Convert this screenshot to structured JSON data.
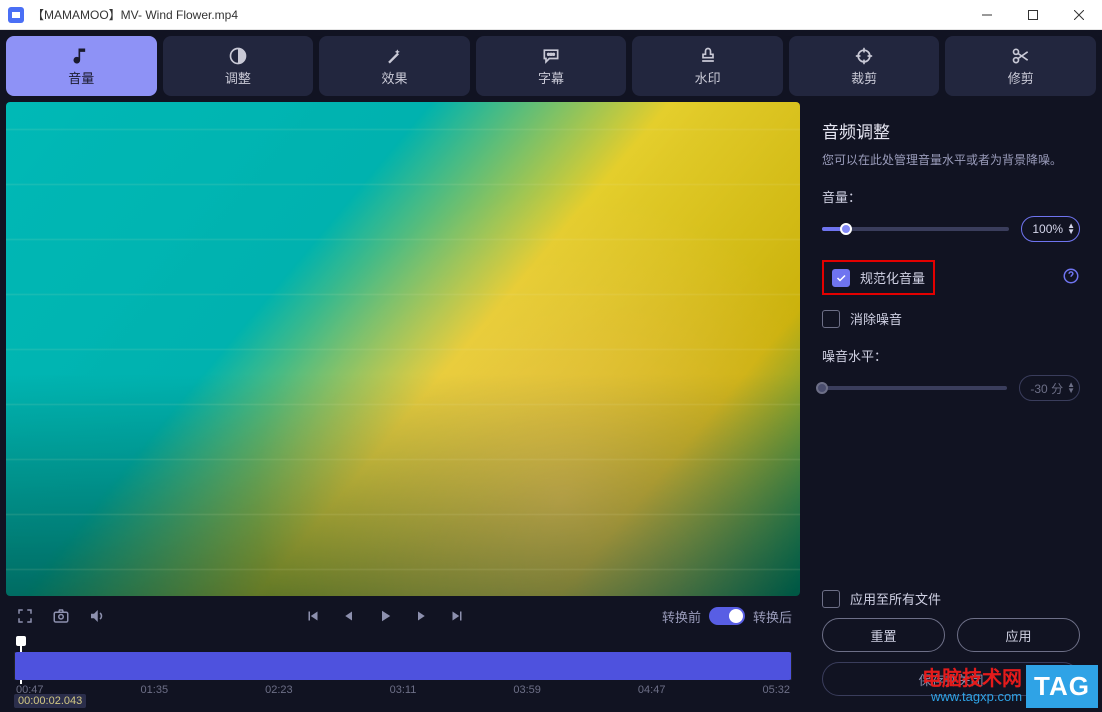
{
  "titlebar": {
    "title": "【MAMAMOO】MV- Wind Flower.mp4"
  },
  "tabs": [
    {
      "label": "音量",
      "icon": "music-note-icon",
      "active": true
    },
    {
      "label": "调整",
      "icon": "contrast-icon",
      "active": false
    },
    {
      "label": "效果",
      "icon": "wand-icon",
      "active": false
    },
    {
      "label": "字幕",
      "icon": "speech-bubble-icon",
      "active": false
    },
    {
      "label": "水印",
      "icon": "stamp-icon",
      "active": false
    },
    {
      "label": "裁剪",
      "icon": "crop-icon",
      "active": false
    },
    {
      "label": "修剪",
      "icon": "scissors-icon",
      "active": false
    }
  ],
  "controls": {
    "before_label": "转换前",
    "after_label": "转换后"
  },
  "timeline": {
    "current": "00:00:02.043",
    "ticks": [
      "00:47",
      "01:35",
      "02:23",
      "03:11",
      "03:59",
      "04:47",
      "05:32"
    ]
  },
  "panel": {
    "title": "音频调整",
    "desc": "您可以在此处管理音量水平或者为背景降噪。",
    "volume_label": "音量：",
    "volume_value": "100%",
    "volume_pct": 13,
    "normalize_label": "规范化音量",
    "denoise_label": "消除噪音",
    "noise_level_label": "噪音水平：",
    "noise_level_value": "-30 分",
    "apply_all_label": "应用至所有文件",
    "reset_label": "重置",
    "apply_label": "应用",
    "save_close_label": "保存并关闭"
  },
  "watermark": {
    "title": "电脑技术网",
    "url": "www.tagxp.com",
    "tag": "TAG"
  }
}
